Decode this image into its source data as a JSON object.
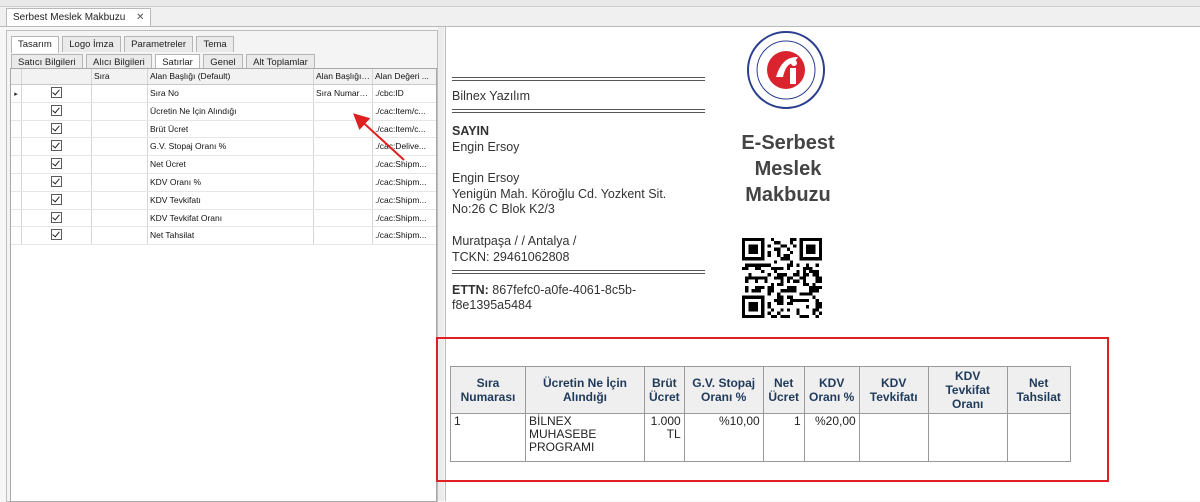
{
  "document_tab": {
    "label": "Serbest Meslek Makbuzu",
    "close": "✕"
  },
  "designer": {
    "tabs_top": [
      "Tasarım",
      "Logo İmza",
      "Parametreler",
      "Tema"
    ],
    "tabs_sub": [
      "Satıcı Bilgileri",
      "Alıcı Bilgileri",
      "Satırlar",
      "Genel",
      "Alt Toplamlar"
    ],
    "columns": [
      "",
      "Sıra",
      "Alan Başlığı (Default)",
      "Alan Başlığı ...",
      "Alan Değeri ..."
    ],
    "rows": [
      {
        "default": "Sıra No",
        "custom": "Sıra Numarası",
        "value": "./cbc:ID",
        "selected": true
      },
      {
        "default": "Ücretin Ne İçin Alındığı",
        "custom": "",
        "value": "./cac:Item/c...",
        "selected": false
      },
      {
        "default": "Brüt Ücret",
        "custom": "",
        "value": "./cac:Item/c...",
        "selected": false
      },
      {
        "default": "G.V. Stopaj Oranı %",
        "custom": "",
        "value": "./cac:Delive...",
        "selected": false
      },
      {
        "default": "Net Ücret",
        "custom": "",
        "value": "./cac:Shipm...",
        "selected": false
      },
      {
        "default": "KDV Oranı %",
        "custom": "",
        "value": "./cac:Shipm...",
        "selected": false
      },
      {
        "default": "KDV Tevkifatı",
        "custom": "",
        "value": "./cac:Shipm...",
        "selected": false
      },
      {
        "default": "KDV Tevkifat Oranı",
        "custom": "",
        "value": "./cac:Shipm...",
        "selected": false
      },
      {
        "default": "Net Tahsilat",
        "custom": "",
        "value": "./cac:Shipm...",
        "selected": false
      }
    ]
  },
  "preview": {
    "seller": "Bilnex Yazılım",
    "sayin": "SAYIN",
    "recipient_name": "Engin Ersoy",
    "address_name": "Engin Ersoy",
    "address_line1": "Yenigün Mah. Köroğlu Cd. Yozkent Sit.",
    "address_line2": "No:26 C Blok K2/3",
    "city": "Muratpaşa / / Antalya /",
    "tckn": "TCKN: 29461062808",
    "ettn_label": "ETTN:",
    "ettn_value": "867fefc0-a0fe-4061-8c5b-",
    "ettn_value2": "f8e1395a5484",
    "title_lines": [
      "E-Serbest",
      "Meslek",
      "Makbuzu"
    ],
    "logo_icon": "gib-logo-seal",
    "qr_icon": "qr-code",
    "table": {
      "headers": [
        [
          "Sıra",
          "Numarası"
        ],
        [
          "Ücretin Ne İçin",
          "Alındığı"
        ],
        [
          "Brüt",
          "Ücret"
        ],
        [
          "G.V. Stopaj",
          "Oranı %"
        ],
        [
          "Net",
          "Ücret"
        ],
        [
          "KDV",
          "Oranı %"
        ],
        [
          "KDV",
          "Tevkifatı"
        ],
        [
          "KDV",
          "Tevkifat",
          "Oranı"
        ],
        [
          "Net",
          "Tahsilat"
        ]
      ],
      "row": {
        "sira": "1",
        "desc": [
          "BİLNEX",
          "MUHASEBE",
          "PROGRAMI"
        ],
        "brut": [
          "1.000",
          "TL"
        ],
        "stopaj": "%10,00",
        "net": "1",
        "kdv": "%20,00",
        "tevkifat": "",
        "tevkifat_oran": "",
        "tahsilat": ""
      }
    }
  },
  "colors": {
    "highlight_box": "#e02020",
    "arrow": "#e02020",
    "header_text": "#1f3a5a",
    "logo_red": "#d9232e"
  }
}
